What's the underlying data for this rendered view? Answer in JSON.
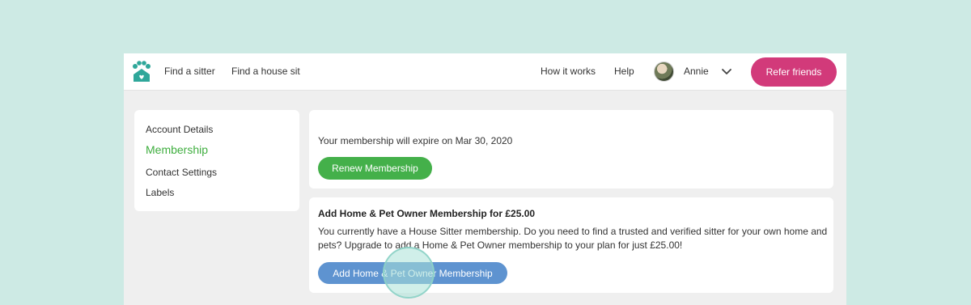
{
  "header": {
    "nav_find_sitter": "Find a sitter",
    "nav_find_house_sit": "Find a house sit",
    "nav_how_it_works": "How it works",
    "nav_help": "Help",
    "user_name": "Annie",
    "refer_button": "Refer friends"
  },
  "sidebar": {
    "items": [
      {
        "label": "Account Details"
      },
      {
        "label": "Membership"
      },
      {
        "label": "Contact Settings"
      },
      {
        "label": "Labels"
      }
    ]
  },
  "membership_card": {
    "expiry_text": "Your membership will expire on Mar 30, 2020",
    "renew_button": "Renew Membership"
  },
  "upgrade_card": {
    "title": "Add Home & Pet Owner Membership for £25.00",
    "body": "You currently have a House Sitter membership. Do you need to find a trusted and verified sitter for your own home and pets? Upgrade to add a Home & Pet Owner membership to your plan for just £25.00!",
    "add_button": "Add Home & Pet Owner Membership"
  },
  "colors": {
    "page_background": "#cdeae4",
    "logo_teal": "#2fa79a",
    "accent_pink": "#d23a7a",
    "active_green": "#3fae3f",
    "button_green": "#44b04a",
    "button_blue": "#5e93d0"
  },
  "icons": {
    "logo": "paw-house-logo-icon",
    "avatar": "user-avatar",
    "dropdown": "chevron-down-icon"
  }
}
